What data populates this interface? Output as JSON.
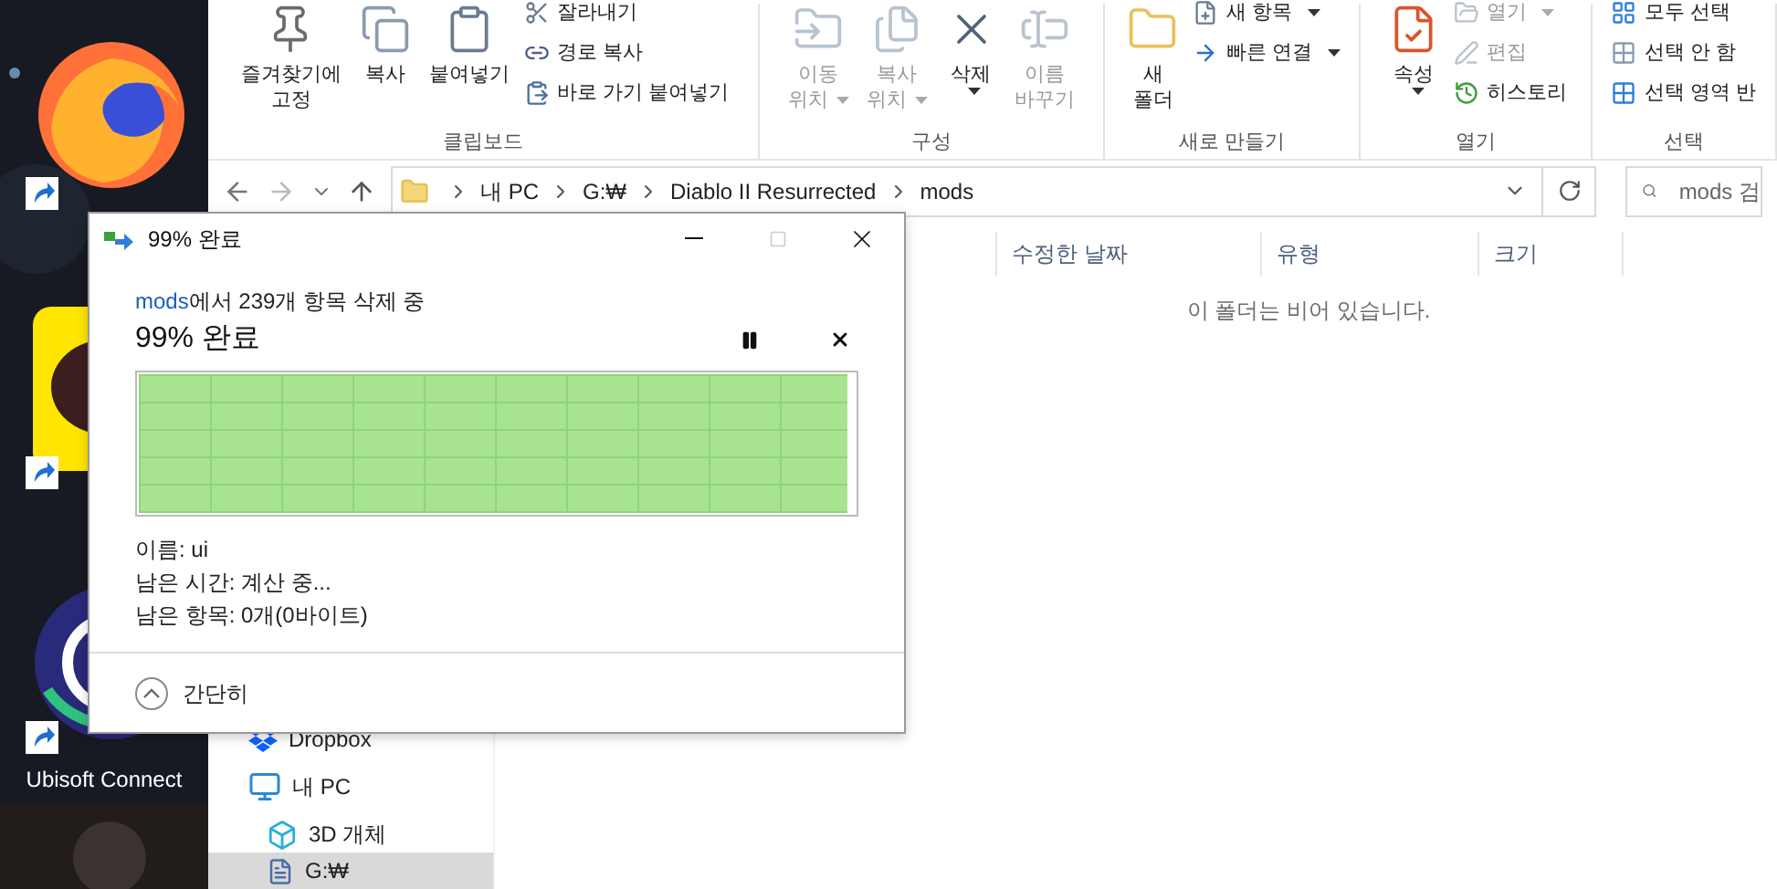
{
  "desktop": {
    "icons": [
      {
        "kind": "browser"
      },
      {
        "kind": "chat"
      },
      {
        "kind": "game",
        "label": "Ubisoft Connect"
      }
    ]
  },
  "ribbon": {
    "groups": [
      {
        "title": "클립보드",
        "items": [
          {
            "kind": "large",
            "lines": [
              "즐겨찾기에",
              "고정"
            ],
            "disabled": false
          },
          {
            "kind": "large",
            "lines": [
              "복사"
            ],
            "disabled": false
          },
          {
            "kind": "large",
            "lines": [
              "붙여넣기"
            ],
            "disabled": false
          },
          {
            "kind": "small",
            "lines": [
              "잘라내기"
            ],
            "disabled": false
          },
          {
            "kind": "small",
            "lines": [
              "경로 복사"
            ],
            "disabled": false
          },
          {
            "kind": "small",
            "lines": [
              "바로 가기 붙여넣기"
            ],
            "disabled": false
          }
        ]
      },
      {
        "title": "구성",
        "items": [
          {
            "kind": "large",
            "lines": [
              "이동",
              "위치"
            ],
            "disabled": true,
            "dropdown": true
          },
          {
            "kind": "large",
            "lines": [
              "복사",
              "위치"
            ],
            "disabled": true,
            "dropdown": true
          },
          {
            "kind": "large",
            "lines": [
              "삭제"
            ],
            "disabled": false,
            "dropdown": true
          },
          {
            "kind": "large",
            "lines": [
              "이름",
              "바꾸기"
            ],
            "disabled": true
          }
        ]
      },
      {
        "title": "새로 만들기",
        "items": [
          {
            "kind": "large",
            "lines": [
              "새",
              "폴더"
            ],
            "disabled": false
          },
          {
            "kind": "small",
            "lines": [
              "새 항목"
            ],
            "disabled": false,
            "dropdown": true
          },
          {
            "kind": "small",
            "lines": [
              "빠른 연결"
            ],
            "disabled": false,
            "dropdown": true
          }
        ]
      },
      {
        "title": "열기",
        "items": [
          {
            "kind": "large",
            "lines": [
              "속성"
            ],
            "disabled": false,
            "dropdown": true
          },
          {
            "kind": "small",
            "lines": [
              "열기"
            ],
            "disabled": true,
            "dropdown": true
          },
          {
            "kind": "small",
            "lines": [
              "편집"
            ],
            "disabled": true
          },
          {
            "kind": "small",
            "lines": [
              "히스토리"
            ],
            "disabled": false
          }
        ]
      },
      {
        "title": "선택",
        "items": [
          {
            "kind": "small",
            "lines": [
              "모두 선택"
            ],
            "disabled": false
          },
          {
            "kind": "small",
            "lines": [
              "선택 안 함"
            ],
            "disabled": false
          },
          {
            "kind": "small",
            "lines": [
              "선택 영역 반"
            ],
            "disabled": false
          }
        ]
      }
    ]
  },
  "address": {
    "path": [
      "내 PC",
      "G:₩",
      "Diablo II Resurrected",
      "mods"
    ],
    "search_placeholder": "mods 검"
  },
  "columns": [
    "수정한 날짜",
    "유형",
    "크기"
  ],
  "empty_message": "이 폴더는 비어 있습니다.",
  "nav_pane": {
    "items": [
      {
        "kind": "dropbox",
        "label": "Dropbox",
        "selected": false
      },
      {
        "kind": "pc",
        "label": "내 PC",
        "selected": false,
        "children": [
          {
            "kind": "objects3d",
            "label": "3D 개체",
            "selected": false
          },
          {
            "kind": "drive",
            "label": "G:₩",
            "selected": true
          }
        ]
      }
    ]
  },
  "dialog": {
    "title": "99% 완료",
    "maximize_disabled": true,
    "source": "mods",
    "status": "에서 239개 항목 삭제 중",
    "heading": "99% 완료",
    "progress": {
      "level": 0.99
    },
    "details": [
      "이름: ui",
      "남은 시간: 계산 중...",
      "남은 항목: 0개(0바이트)"
    ],
    "toggle": "간단히"
  }
}
